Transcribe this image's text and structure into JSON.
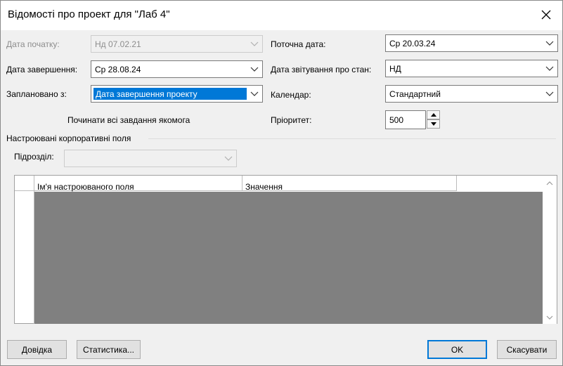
{
  "window": {
    "title": "Відомості про проект для \"Лаб 4\""
  },
  "fields": {
    "start_date": {
      "label": "Дата початку:",
      "value": "Нд 07.02.21"
    },
    "finish_date": {
      "label": "Дата завершення:",
      "value": "Ср 28.08.24"
    },
    "schedule_from": {
      "label": "Заплановано з:",
      "value": "Дата завершення проекту"
    },
    "all_tasks_note": "Починати всі завдання якомога",
    "current_date": {
      "label": "Поточна дата:",
      "value": "Ср 20.03.24"
    },
    "status_date": {
      "label": "Дата звітування про стан:",
      "value": "НД"
    },
    "calendar": {
      "label": "Календар:",
      "value": "Стандартний"
    },
    "priority": {
      "label": "Пріоритет:",
      "value": "500"
    }
  },
  "custom_fields": {
    "group_label": "Настроювані корпоративні поля",
    "department_label": "Підрозділ:",
    "department_value": "",
    "columns": [
      "Ім'я настроюваного поля",
      "Значення"
    ]
  },
  "buttons": {
    "help": "Довідка",
    "statistics": "Статистика...",
    "ok": "OK",
    "cancel": "Скасувати"
  },
  "icons": {
    "close": "close-icon",
    "dropdown": "chevron-down-icon",
    "spin_up": "spin-up-icon",
    "spin_down": "spin-down-icon",
    "scroll_up": "scroll-up-icon",
    "scroll_down": "scroll-down-icon"
  },
  "colors": {
    "accent": "#0078d7",
    "grid_fill": "#808080",
    "dialog_bg": "#f0f0f0"
  }
}
